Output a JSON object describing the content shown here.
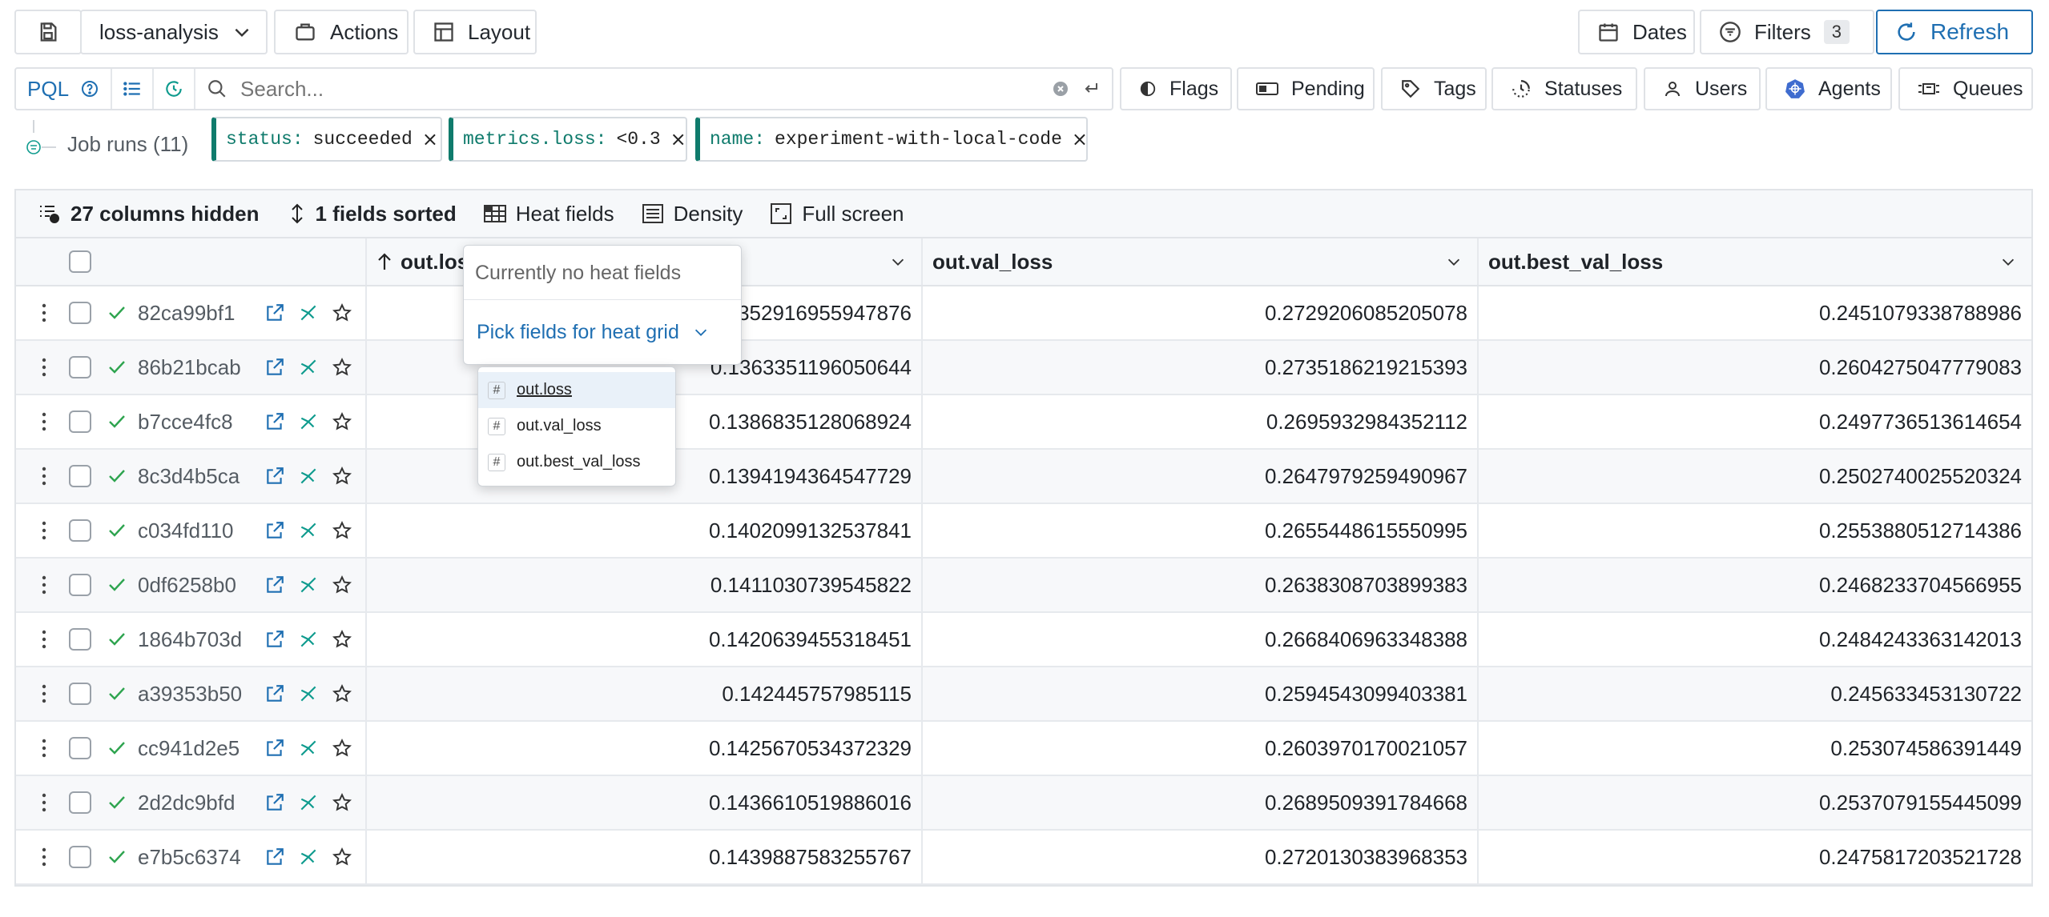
{
  "topbar": {
    "project": "loss-analysis",
    "actions_label": "Actions",
    "layout_label": "Layout",
    "dates_label": "Dates",
    "filters_label": "Filters",
    "filters_count": "3",
    "refresh_label": "Refresh"
  },
  "search": {
    "pql_label": "PQL",
    "placeholder": "Search..."
  },
  "quick_filters": [
    "Flags",
    "Pending",
    "Tags",
    "Statuses",
    "Users",
    "Agents",
    "Queues"
  ],
  "runs_label": "Job runs (11)",
  "active_filters": [
    {
      "key": "status:",
      "value": "succeeded"
    },
    {
      "key": "metrics.loss:",
      "value": "<0.3"
    },
    {
      "key": "name:",
      "value": "experiment-with-local-code"
    }
  ],
  "table_toolbar": {
    "hidden_columns": "27 columns hidden",
    "sorted": "1 fields sorted",
    "heat_fields": "Heat fields",
    "density": "Density",
    "full_screen": "Full screen"
  },
  "columns": [
    "out.loss",
    "out.val_loss",
    "out.best_val_loss"
  ],
  "rows": [
    {
      "id": "82ca99bf1",
      "loss": "0.1352916955947876",
      "val_loss": "0.2729206085205078",
      "best_val_loss": "0.2451079338788986"
    },
    {
      "id": "86b21bcab",
      "loss": "0.1363351196050644",
      "val_loss": "0.2735186219215393",
      "best_val_loss": "0.2604275047779083"
    },
    {
      "id": "b7cce4fc8",
      "loss": "0.1386835128068924",
      "val_loss": "0.2695932984352112",
      "best_val_loss": "0.2497736513614654"
    },
    {
      "id": "8c3d4b5ca",
      "loss": "0.1394194364547729",
      "val_loss": "0.2647979259490967",
      "best_val_loss": "0.2502740025520324"
    },
    {
      "id": "c034fd110",
      "loss": "0.1402099132537841",
      "val_loss": "0.2655448615550995",
      "best_val_loss": "0.2553880512714386"
    },
    {
      "id": "0df6258b0",
      "loss": "0.1411030739545822",
      "val_loss": "0.2638308703899383",
      "best_val_loss": "0.2468233704566955"
    },
    {
      "id": "1864b703d",
      "loss": "0.1420639455318451",
      "val_loss": "0.2668406963348388",
      "best_val_loss": "0.2484243363142013"
    },
    {
      "id": "a39353b50",
      "loss": "0.142445757985115",
      "val_loss": "0.2594543099403381",
      "best_val_loss": "0.245633453130722"
    },
    {
      "id": "cc941d2e5",
      "loss": "0.1425670534372329",
      "val_loss": "0.2603970170021057",
      "best_val_loss": "0.253074586391449"
    },
    {
      "id": "2d2dc9bfd",
      "loss": "0.1436610519886016",
      "val_loss": "0.2689509391784668",
      "best_val_loss": "0.2537079155445099"
    },
    {
      "id": "e7b5c6374",
      "loss": "0.1439887583255767",
      "val_loss": "0.2720130383968353",
      "best_val_loss": "0.2475817203521728"
    }
  ],
  "heat_popover": {
    "empty_text": "Currently no heat fields",
    "pick_label": "Pick fields for heat grid",
    "options": [
      "out.loss",
      "out.val_loss",
      "out.best_val_loss"
    ]
  },
  "colors": {
    "accent": "#1f6fb2",
    "success": "#2ea44f",
    "filter_key": "#0f7b6c"
  }
}
